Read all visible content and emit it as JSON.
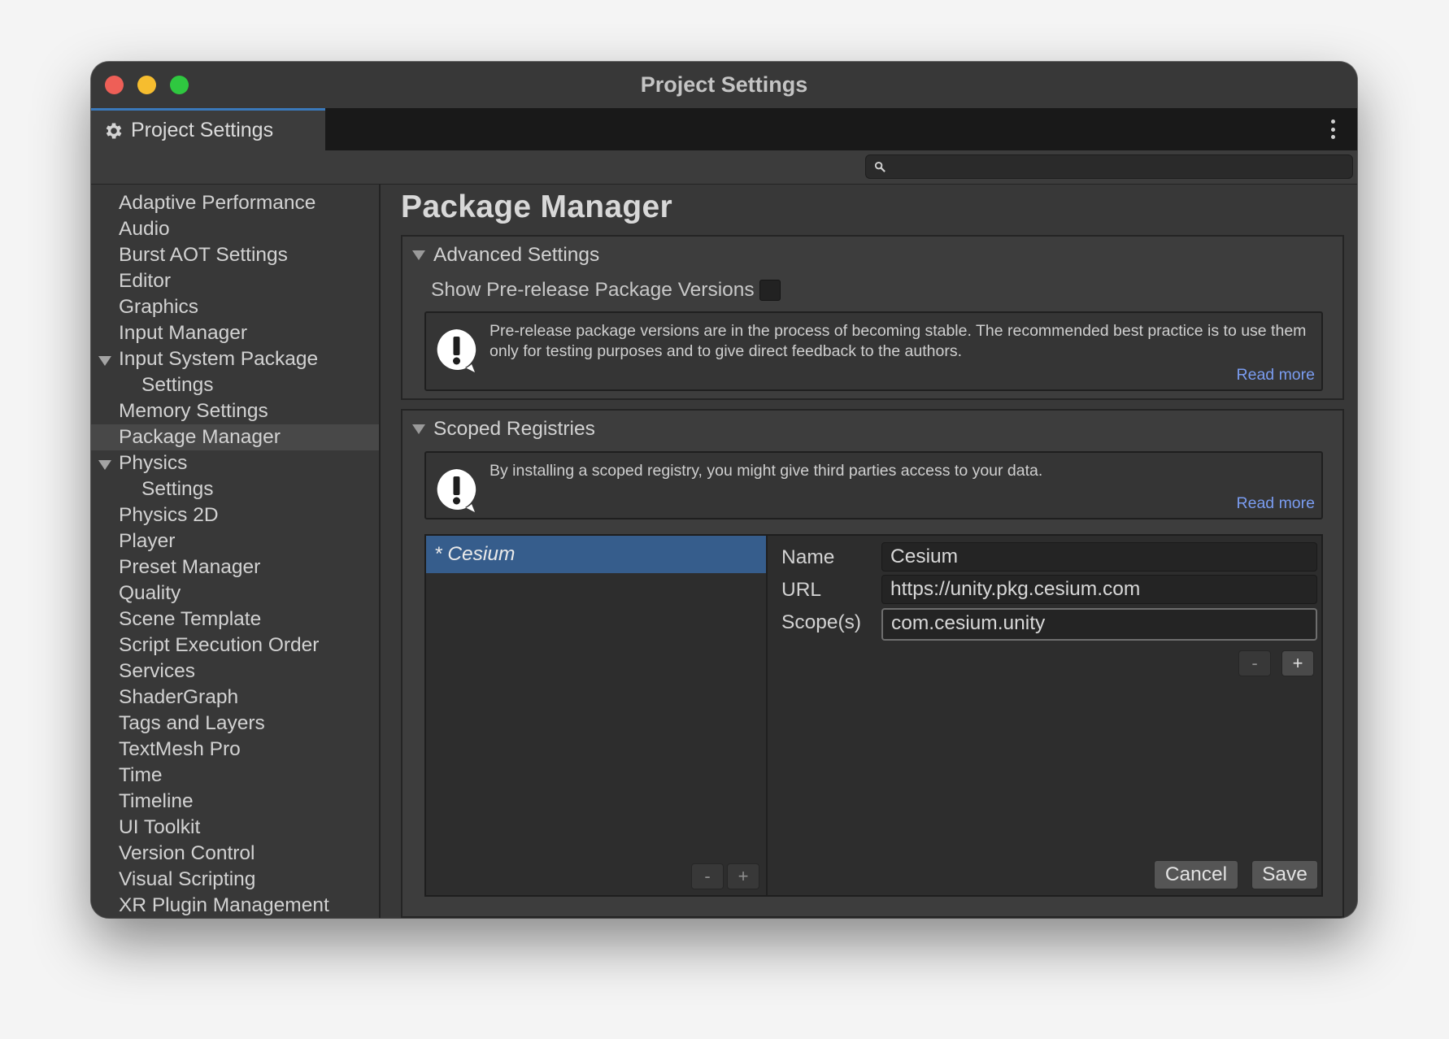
{
  "window": {
    "title": "Project Settings"
  },
  "tab": {
    "label": "Project Settings",
    "icon": "gear-icon"
  },
  "search": {
    "placeholder": "",
    "icon": "search-icon"
  },
  "sidebar": {
    "items": [
      {
        "label": "Adaptive Performance"
      },
      {
        "label": "Audio"
      },
      {
        "label": "Burst AOT Settings"
      },
      {
        "label": "Editor"
      },
      {
        "label": "Graphics"
      },
      {
        "label": "Input Manager"
      },
      {
        "label": "Input System Package"
      },
      {
        "label": "Settings"
      },
      {
        "label": "Memory Settings"
      },
      {
        "label": "Package Manager"
      },
      {
        "label": "Physics"
      },
      {
        "label": "Settings"
      },
      {
        "label": "Physics 2D"
      },
      {
        "label": "Player"
      },
      {
        "label": "Preset Manager"
      },
      {
        "label": "Quality"
      },
      {
        "label": "Scene Template"
      },
      {
        "label": "Script Execution Order"
      },
      {
        "label": "Services"
      },
      {
        "label": "ShaderGraph"
      },
      {
        "label": "Tags and Layers"
      },
      {
        "label": "TextMesh Pro"
      },
      {
        "label": "Time"
      },
      {
        "label": "Timeline"
      },
      {
        "label": "UI Toolkit"
      },
      {
        "label": "Version Control"
      },
      {
        "label": "Visual Scripting"
      },
      {
        "label": "XR Plugin Management"
      }
    ],
    "selected": "Package Manager"
  },
  "main": {
    "title": "Package Manager",
    "advanced": {
      "heading": "Advanced Settings",
      "prerelease_label": "Show Pre-release Package Versions",
      "prerelease_checked": false,
      "help_text": "Pre-release package versions are in the process of becoming stable. The recommended best practice is to use them only for testing purposes and to give direct feedback to the authors.",
      "read_more": "Read more"
    },
    "scoped": {
      "heading": "Scoped Registries",
      "help_text": "By installing a scoped registry, you might give third parties access to your data.",
      "read_more": "Read more",
      "registries": [
        {
          "label": "* Cesium"
        }
      ],
      "list_remove": "-",
      "list_add": "+",
      "name_label": "Name",
      "name_value": "Cesium",
      "url_label": "URL",
      "url_value": "https://unity.pkg.cesium.com",
      "scope_label": "Scope(s)",
      "scope_value": "com.cesium.unity",
      "scope_remove": "-",
      "scope_add": "+",
      "cancel": "Cancel",
      "save": "Save"
    }
  }
}
